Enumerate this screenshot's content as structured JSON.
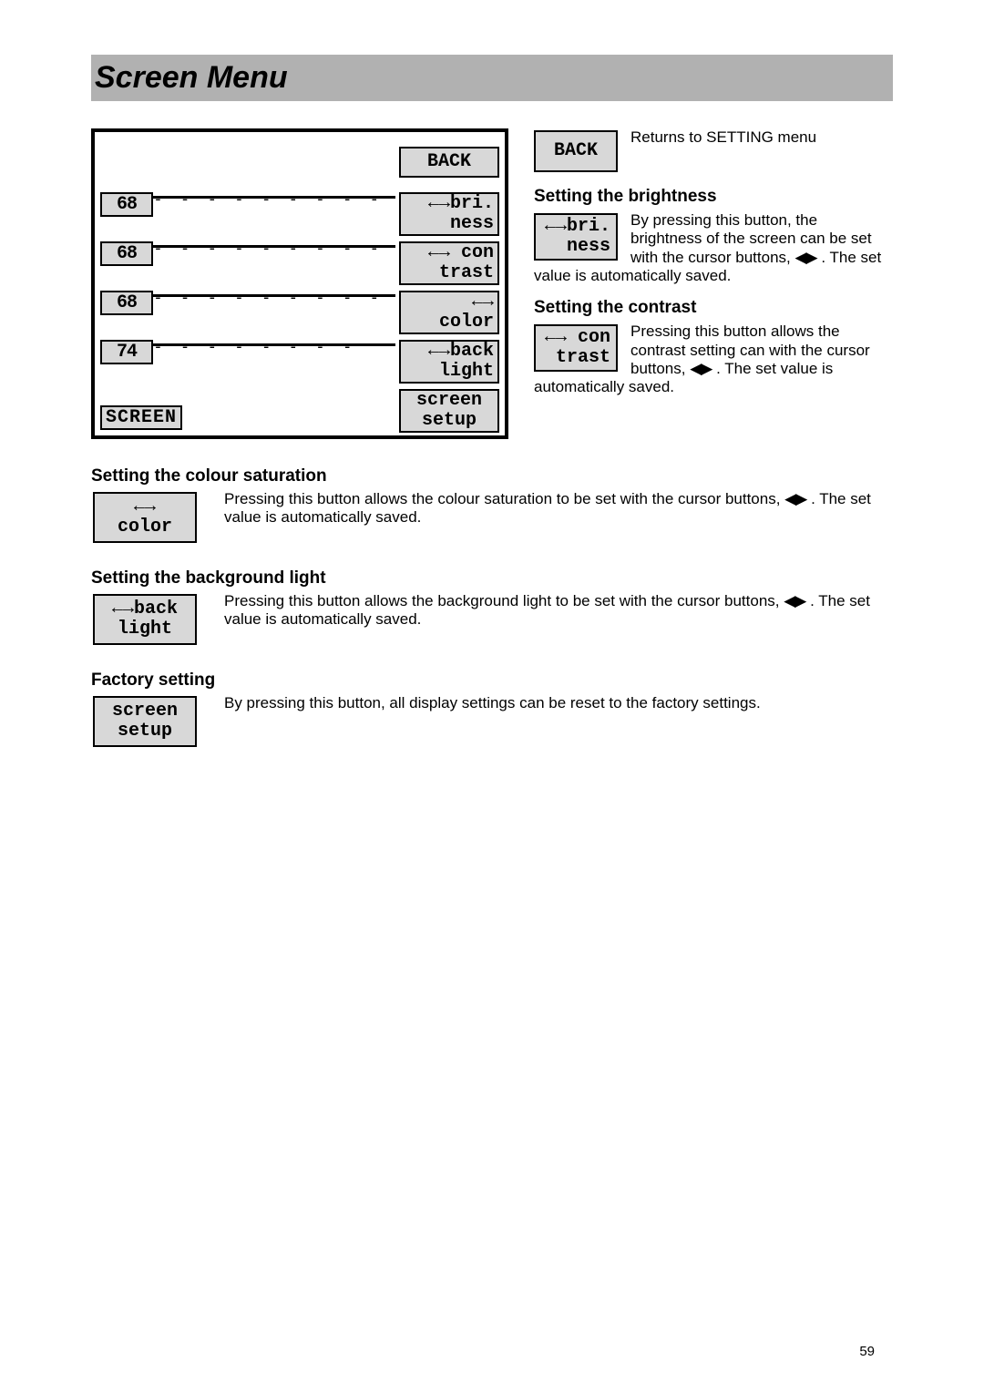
{
  "title": "Screen Menu",
  "page_number": "59",
  "cursor_glyph": "◀▶",
  "arrow_glyph": "←→",
  "device": {
    "back_label": "BACK",
    "rows": [
      {
        "value": "68",
        "btn_l1": "←→bri.",
        "btn_l2": "ness"
      },
      {
        "value": "68",
        "btn_l1": "←→ con",
        "btn_l2": "trast"
      },
      {
        "value": "68",
        "btn_l1": "←→",
        "btn_l2": "color"
      },
      {
        "value": "74",
        "btn_l1": "←→back",
        "btn_l2": "light"
      }
    ],
    "setup_l1": "screen",
    "setup_l2": "setup",
    "screen_label": "SCREEN"
  },
  "right": {
    "back": {
      "btn": "BACK",
      "text": "Returns to SETTING menu"
    },
    "brightness": {
      "heading": "Setting the brightness",
      "btn_l1": "←→bri.",
      "btn_l2": "ness",
      "text_a": "By pressing this button, the brightness of the screen can be set with the cursor buttons, ",
      "text_b": ". The set value is automatically saved."
    },
    "contrast": {
      "heading": "Setting the contrast",
      "btn_l1": "←→ con",
      "btn_l2": "trast",
      "text_a": "Pressing this button allows the contrast setting can with the cursor buttons, ",
      "text_b": ". The set value is automatically saved."
    }
  },
  "lower": {
    "color": {
      "heading": "Setting the colour saturation",
      "btn_l1": "←→",
      "btn_l2": "color",
      "text_a": "Pressing this button allows the colour saturation to be set with the cursor buttons, ",
      "text_b": ". The set value is automatically saved."
    },
    "backlight": {
      "heading": "Setting the background light",
      "btn_l1": "←→back",
      "btn_l2": "light",
      "text_a": "Pressing this button allows the background light to be set with the cursor buttons, ",
      "text_b": ". The set value is automatically saved."
    },
    "factory": {
      "heading": "Factory setting",
      "btn_l1": "screen",
      "btn_l2": "setup",
      "text": "By pressing this button, all display settings can be reset to the factory settings."
    }
  }
}
